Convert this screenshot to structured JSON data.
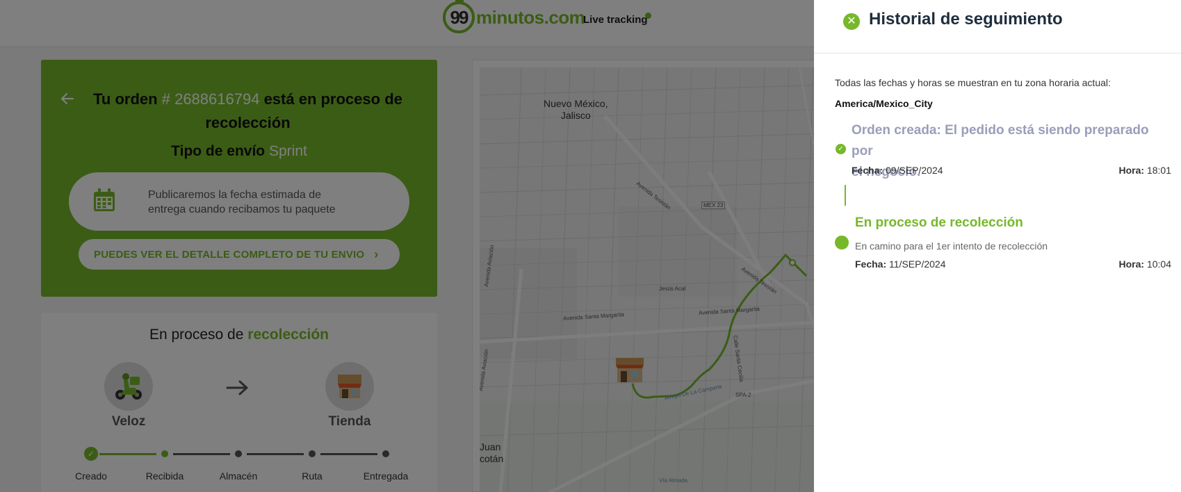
{
  "header": {
    "logo_number": "99",
    "logo_text": "minutos.com",
    "live_label": "Live tracking"
  },
  "order": {
    "prefix": "Tu orden",
    "hash": "#",
    "number": "2688616794",
    "status_text": "está en proceso de recolección",
    "ship_type_label": "Tipo de envío",
    "ship_type_value": "Sprint",
    "estimate_line1": "Publicaremos la fecha estimada de",
    "estimate_line2": "entrega cuando recibamos tu paquete",
    "detail_button": "PUEDES VER EL DETALLE COMPLETO DE TU ENVIO"
  },
  "progress": {
    "title_prefix": "En proceso de",
    "title_highlight": "recolección",
    "from_label": "Veloz",
    "to_label": "Tienda",
    "steps": [
      {
        "label": "Creado",
        "state": "done"
      },
      {
        "label": "Recibida",
        "state": "current"
      },
      {
        "label": "Almacén",
        "state": "pending"
      },
      {
        "label": "Ruta",
        "state": "pending"
      },
      {
        "label": "Entregada",
        "state": "pending"
      }
    ]
  },
  "map": {
    "labels": {
      "nuevo_mexico": "Nuevo México,",
      "jalisco": "Jalisco",
      "av_tesistan": "Avenida Tesistán",
      "mex23": "MEX 23",
      "jesus_acal": "Jesús Acal",
      "av_tesistan2": "Avenida Tesistán",
      "av_santa_margarita": "Avenida Santa Margarita",
      "av_santa_margarita2": "Avenida Santa Margarita",
      "av_aviacion": "Avenida Aviación",
      "av_aviacion2": "Avenida Aviación",
      "calle_santa_cecilia": "Calle Santa Cecilia",
      "arroyo": "Arroyo De La Campana",
      "spa2": "SPA-2",
      "juan_cotan_1": "Juan",
      "juan_cotan_2": "cotán",
      "via_almada": "Vía Almada"
    }
  },
  "panel": {
    "title": "Historial de seguimiento",
    "tz_note": "Todas las fechas y horas se muestran en tu zona horaria actual:",
    "tz_value": "America/Mexico_City",
    "events": [
      {
        "title_line1": "Orden creada: El pedido está siendo preparado por",
        "title_line2": "el negocio.",
        "date_label": "Fecha:",
        "date_value": "09/SEP/2024",
        "hour_label": "Hora:",
        "hour_value": "18:01"
      },
      {
        "title": "En proceso de recolección",
        "description": "En camino para el 1er intento de recolección",
        "date_label": "Fecha:",
        "date_value": "11/SEP/2024",
        "hour_label": "Hora:",
        "hour_value": "10:04"
      }
    ]
  },
  "colors": {
    "brand_green": "#76b82a",
    "overlay": "rgba(0,0,0,0.5)",
    "muted_purple": "#9a9eb8",
    "title_dark": "#1f2d3d"
  }
}
